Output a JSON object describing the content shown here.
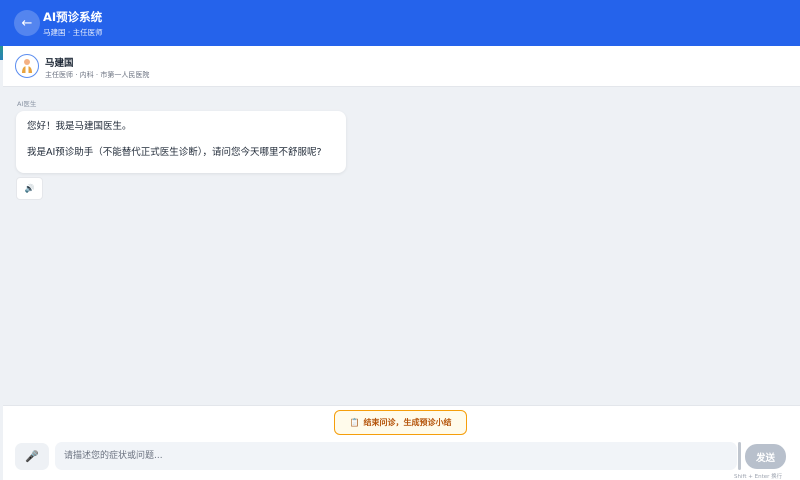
{
  "header": {
    "back_icon": "←",
    "title": "AI预诊系统",
    "subtitle": "马建国 · 主任医师"
  },
  "doctor": {
    "avatar_icon": "doctor-avatar-icon",
    "name": "马建国",
    "meta": "主任医师 · 内科 · 市第一人民医院"
  },
  "chat": {
    "sender_label": "AI医生",
    "messages": [
      {
        "line1": "您好！我是马建国医生。",
        "line2": "我是AI预诊助手（不能替代正式医生诊断），请问您今天哪里不舒服呢?"
      }
    ],
    "speaker_icon": "🔊"
  },
  "footer": {
    "summary_icon": "📋",
    "summary_label": "结束问诊，生成预诊小结",
    "mic_icon": "🎤",
    "input_placeholder": "请描述您的症状或问题...",
    "send_label": "发送",
    "hint": "Shift + Enter 换行"
  },
  "colors": {
    "primary": "#2563eb",
    "summary_border": "#f59e0b",
    "summary_text": "#b45309",
    "send_disabled": "#b8c0cc"
  }
}
